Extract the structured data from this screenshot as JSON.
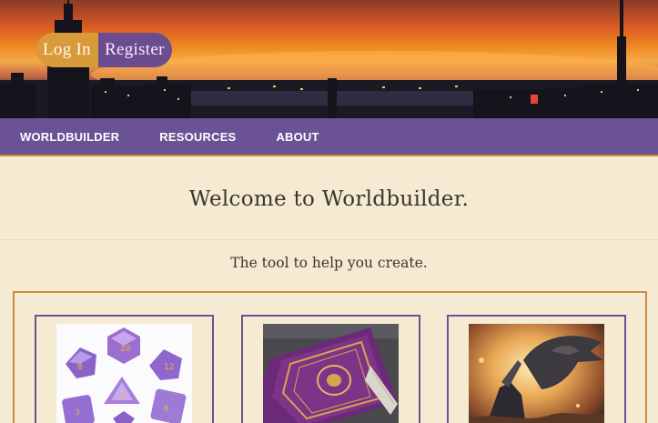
{
  "auth": {
    "login_label": "Log In",
    "register_label": "Register"
  },
  "nav": {
    "items": [
      "WORLDBUILDER",
      "RESOURCES",
      "ABOUT"
    ]
  },
  "welcome": {
    "title": "Welcome to Worldbuilder."
  },
  "tagline": "The tool to help you create.",
  "cards": [
    {
      "image": "dice-set"
    },
    {
      "image": "spellbook-cover"
    },
    {
      "image": "dragon-battle"
    }
  ],
  "colors": {
    "nav": "#6a5295",
    "accent": "#d08a3e",
    "background": "#f5ead2",
    "login": "#d99a3a",
    "register": "#6a4c8f"
  }
}
